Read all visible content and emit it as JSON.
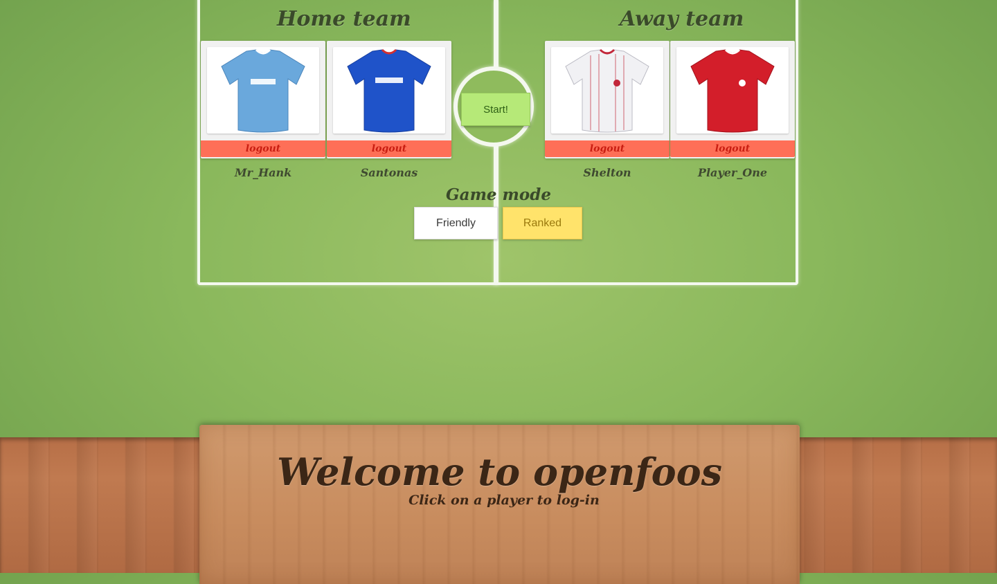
{
  "home": {
    "title": "Home team",
    "players": [
      {
        "name": "Mr_Hank",
        "logout": "logout",
        "jersey": "jersey-sky-blue",
        "color": "#6aa8dc",
        "trim": "#ffffff"
      },
      {
        "name": "Santonas",
        "logout": "logout",
        "jersey": "jersey-royal-blue",
        "color": "#1f53c9",
        "trim": "#d53030"
      }
    ]
  },
  "away": {
    "title": "Away team",
    "players": [
      {
        "name": "Shelton",
        "logout": "logout",
        "jersey": "jersey-white-striped",
        "color": "#f1f1f4",
        "trim": "#c2273a"
      },
      {
        "name": "Player_One",
        "logout": "logout",
        "jersey": "jersey-red",
        "color": "#d31e2a",
        "trim": "#ffffff"
      }
    ]
  },
  "start_label": "Start!",
  "game_mode": {
    "title": "Game mode",
    "options": [
      "Friendly",
      "Ranked"
    ],
    "selected": "Ranked"
  },
  "welcome": {
    "title": "Welcome to openfoos",
    "subtitle": "Click on a player to log-in"
  },
  "colors": {
    "field": "#8fbb5d",
    "logout_bg": "#fe6f57",
    "start_bg": "#b6e978",
    "ranked_bg": "#ffe36b"
  }
}
